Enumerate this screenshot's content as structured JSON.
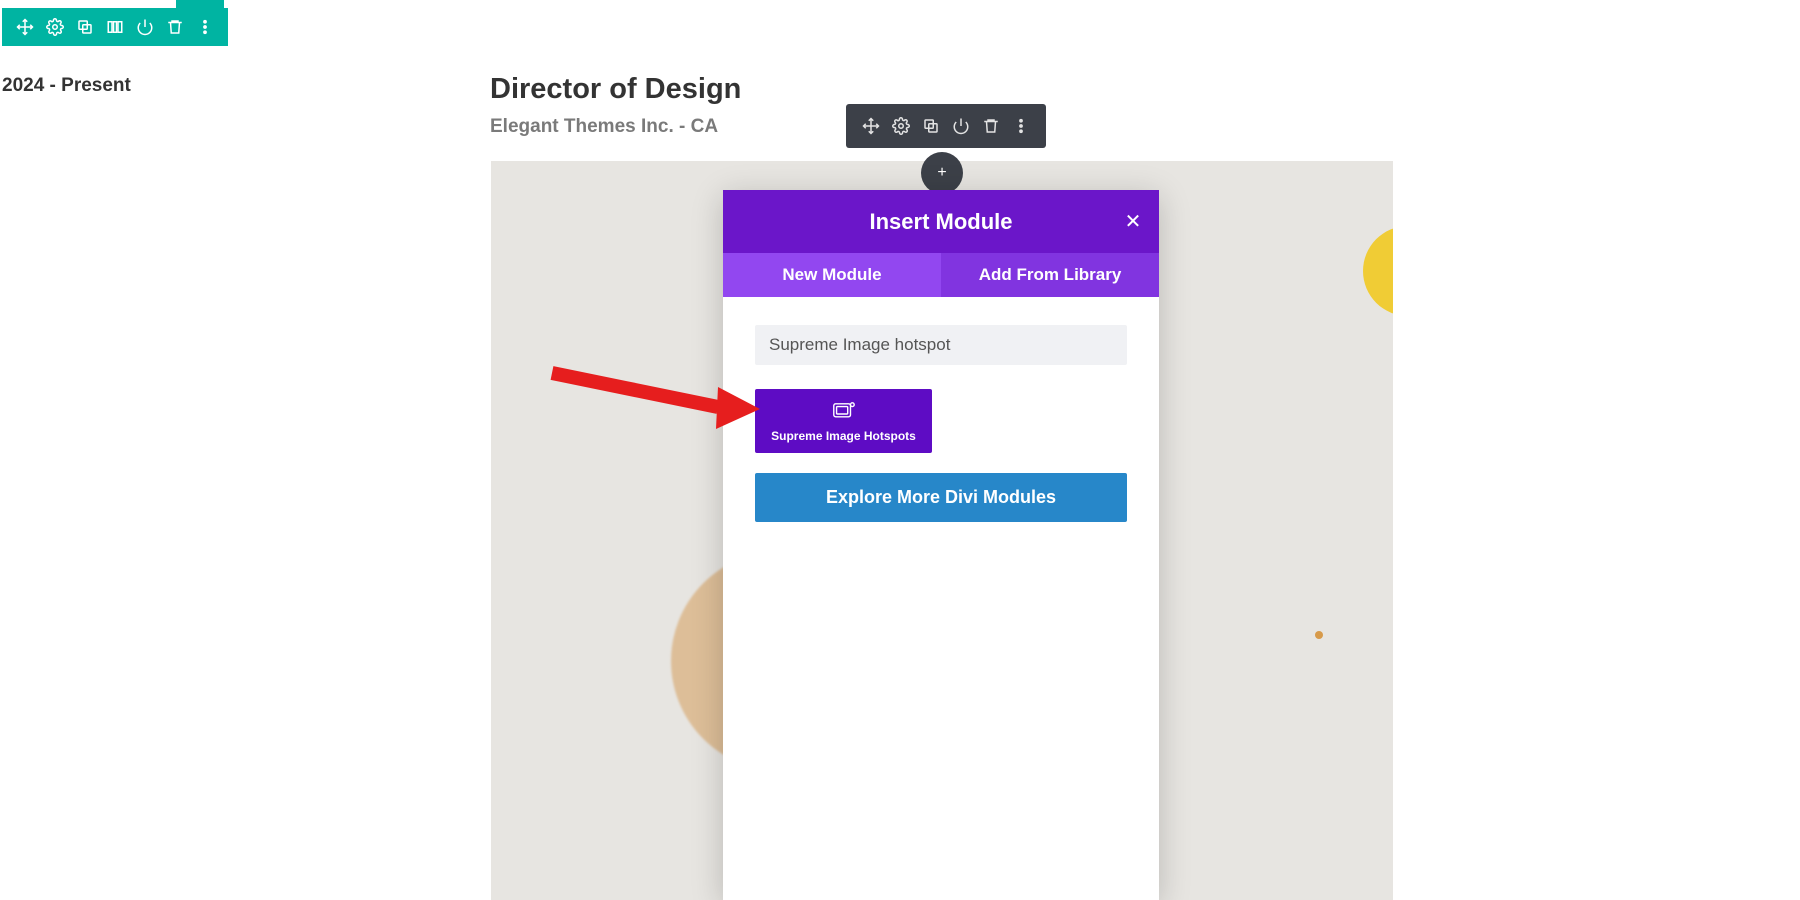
{
  "page": {
    "date_range": "2024 - Present",
    "title": "Director of Design",
    "subtitle": "Elegant Themes Inc. - CA"
  },
  "section_toolbar": {
    "icons": [
      "move-icon",
      "gear-icon",
      "duplicate-icon",
      "columns-icon",
      "power-icon",
      "trash-icon",
      "dots-icon"
    ]
  },
  "row_toolbar": {
    "icons": [
      "move-icon",
      "gear-icon",
      "duplicate-icon",
      "power-icon",
      "trash-icon",
      "dots-icon"
    ]
  },
  "add_button": {
    "label": "+"
  },
  "modal": {
    "title": "Insert Module",
    "close": "✕",
    "tabs": {
      "new": "New Module",
      "library": "Add From Library"
    },
    "search_value": "Supreme Image hotspot",
    "module_card": "Supreme Image Hotspots",
    "explore": "Explore More Divi Modules"
  }
}
